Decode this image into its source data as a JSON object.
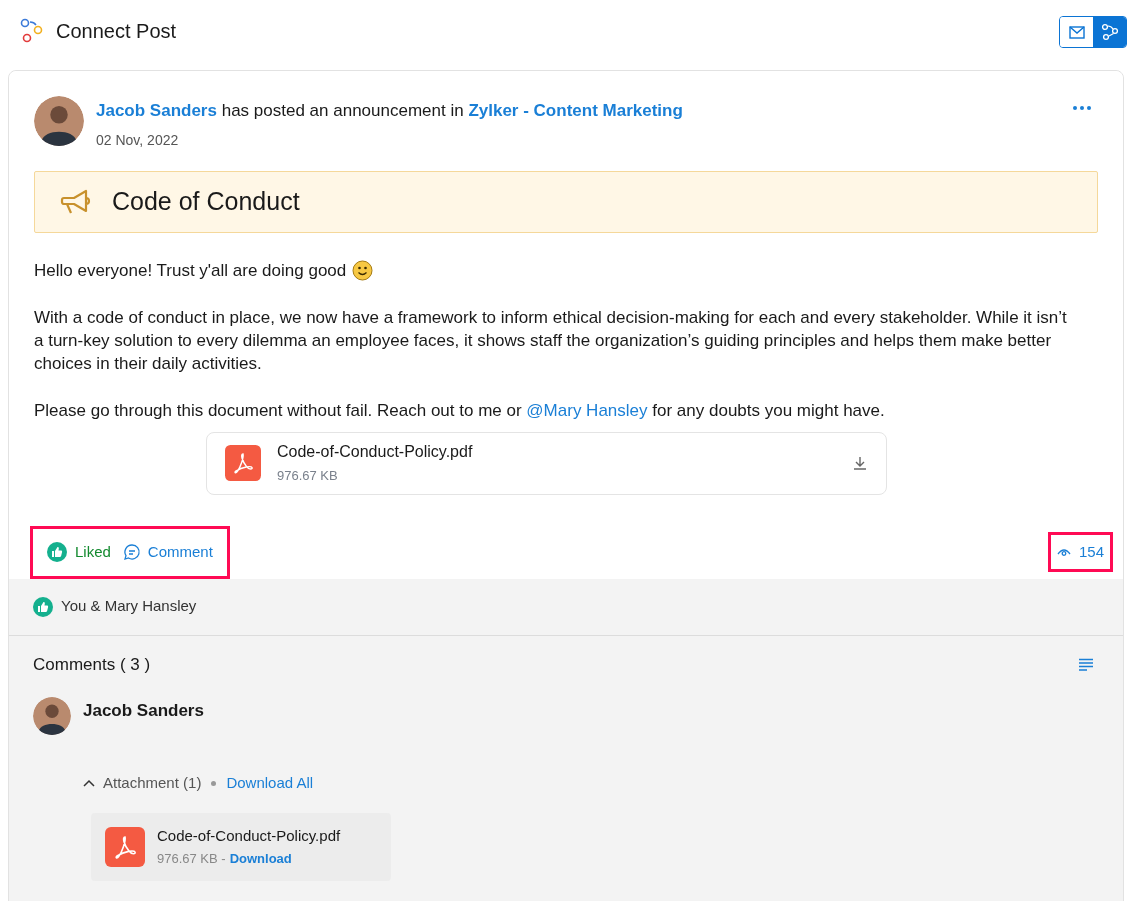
{
  "header": {
    "title": "Connect Post",
    "view_toggle": [
      {
        "kind": "mail",
        "selected": false
      },
      {
        "kind": "connect",
        "selected": true
      }
    ]
  },
  "post": {
    "author": "Jacob Sanders",
    "action": "has posted an announcement in",
    "group": "Zylker - Content Marketing",
    "date": "02 Nov, 2022",
    "announcement_title": "Code of Conduct",
    "paragraphs": [
      {
        "text": "Hello everyone! Trust y'all are doing good",
        "emoji": true
      },
      {
        "text": "With a code of conduct in place, we now have a framework to inform ethical decision-making for each and every stakeholder. While it isn’t a turn-key solution to every dilemma an employee faces, it shows staff the organization’s guiding principles and helps them make better choices in their daily activities.",
        "emoji": false
      }
    ],
    "closing": {
      "before": "Please go through this document without fail. Reach out to me or",
      "mention": "@Mary Hansley",
      "after": "for any doubts you might have."
    },
    "attachment": {
      "name": "Code-of-Conduct-Policy.pdf",
      "size": "976.67 KB"
    },
    "like": {
      "label": "Liked",
      "liked": true
    },
    "comment_label": "Comment",
    "views": "154"
  },
  "likes_summary": "You & Mary Hansley",
  "comments": {
    "title": "Comments ( 3 )",
    "items": [
      {
        "author": "Jacob Sanders",
        "attachment_toggle": "Attachment (1)",
        "expanded": true,
        "download_all": "Download All",
        "file": {
          "name": "Code-of-Conduct-Policy.pdf",
          "size": "976.67 KB -",
          "download": "Download"
        }
      }
    ]
  }
}
